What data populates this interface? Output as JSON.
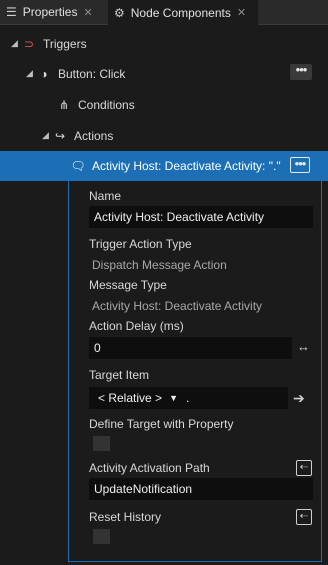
{
  "tabs": [
    {
      "label": "Properties",
      "icon": "list-icon"
    },
    {
      "label": "Node Components",
      "icon": "node-components-icon"
    }
  ],
  "tree": {
    "triggers": "Triggers",
    "button_click": "Button: Click",
    "conditions": "Conditions",
    "actions": "Actions",
    "selected_action": "Activity Host: Deactivate Activity: \".\"",
    "dots": "•••"
  },
  "properties": {
    "name_label": "Name",
    "name_value": "Activity Host: Deactivate Activity",
    "trigger_action_type_label": "Trigger Action Type",
    "trigger_action_type_value": "Dispatch Message Action",
    "message_type_label": "Message Type",
    "message_type_value": "Activity Host: Deactivate Activity",
    "action_delay_label": "Action Delay (ms)",
    "action_delay_value": "0",
    "target_item_label": "Target Item",
    "target_item_dropdown": "< Relative >",
    "target_item_path": ".",
    "define_target_label": "Define Target with Property",
    "activation_path_label": "Activity Activation Path",
    "activation_path_value": "UpdateNotification",
    "reset_history_label": "Reset History"
  },
  "colors": {
    "selection": "#1d6fb5",
    "trigger_icon": "#e0505a"
  }
}
